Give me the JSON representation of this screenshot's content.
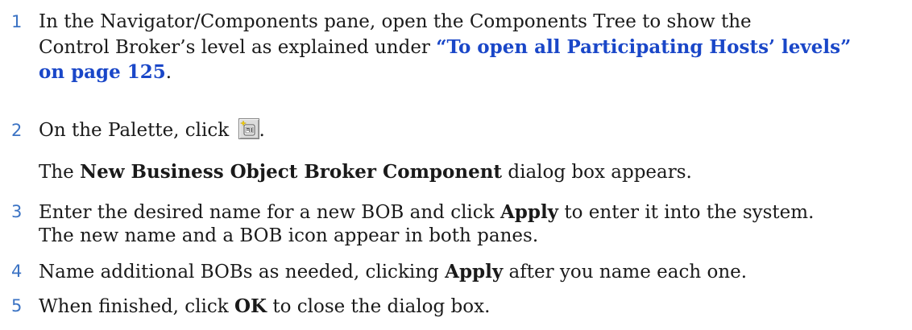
{
  "steps": [
    {
      "num": "1",
      "line1": "In the Navigator/Components pane, open the Components Tree to show the",
      "line2_pre": "Control Broker’s level as explained under ",
      "line2_xref": "“To open all Participating Hosts’ levels”",
      "line3_xref": "on page 125",
      "line3_post": "."
    },
    {
      "num": "2",
      "pre": "On the Palette, click ",
      "icon": "new-bob-component-icon",
      "post": "."
    },
    {
      "num": "3",
      "line1_pre": "Enter the desired name for a new BOB and click ",
      "line1_bold": "Apply",
      "line1_post": " to enter it into the system.",
      "line2": "The new name and a BOB icon appear in both panes."
    },
    {
      "num": "4",
      "pre": "Name additional BOBs as needed, clicking ",
      "bold": "Apply",
      "post": " after you name each one."
    },
    {
      "num": "5",
      "pre": "When finished, click ",
      "bold": "OK",
      "post": " to close the dialog box."
    }
  ],
  "note": {
    "pre": "The ",
    "bold": "New Business Object Broker Component",
    "post": " dialog box appears."
  },
  "colors": {
    "step_number": "#3b73c4",
    "cross_reference": "#1a47c8",
    "text": "#1a1a1a"
  }
}
